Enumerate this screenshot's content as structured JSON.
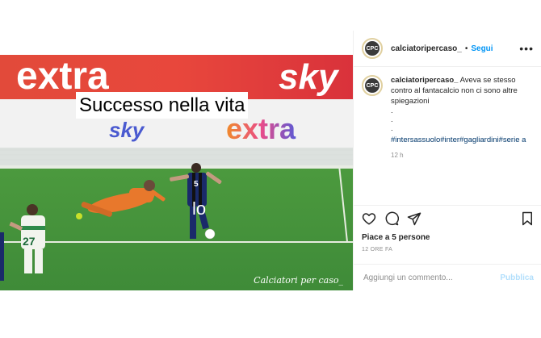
{
  "post": {
    "username": "calciatoripercaso_",
    "separator": "•",
    "follow_label": "Segui",
    "more_icon": "ellipsis-icon",
    "media": {
      "caption_overlay": "Successo nella vita",
      "player_tag": "lo",
      "watermark": "Calciatori per caso_",
      "banner_top_left": "extra",
      "banner_top_right": "sky",
      "banner_mid_left": "sky",
      "banner_mid_right": "extra",
      "player_number": "27",
      "striker_number": "5"
    },
    "comment": {
      "username": "calciatoripercaso_",
      "text": "Aveva se stesso contro al fantacalcio non ci sono altre spiegazioni",
      "dots": [
        ".",
        ".",
        "."
      ],
      "hashtags": "#intersassuolo#inter#gagliardini#serie a",
      "time": "12 h"
    },
    "actions": {
      "like_icon": "heart-icon",
      "comment_icon": "comment-icon",
      "share_icon": "paper-plane-icon",
      "save_icon": "bookmark-icon",
      "likes_text": "Piace a 5 persone",
      "posted_ago": "12 ORE FA"
    },
    "add_comment": {
      "placeholder": "Aggiungi un commento...",
      "publish_label": "Pubblica"
    }
  },
  "colors": {
    "link": "#0095f6",
    "hashtag": "#00376b",
    "muted": "#8e8e8e",
    "publish_disabled": "#b2dffc",
    "pitch_green": "#3f8a3a",
    "banner_red": "#e2433d"
  }
}
